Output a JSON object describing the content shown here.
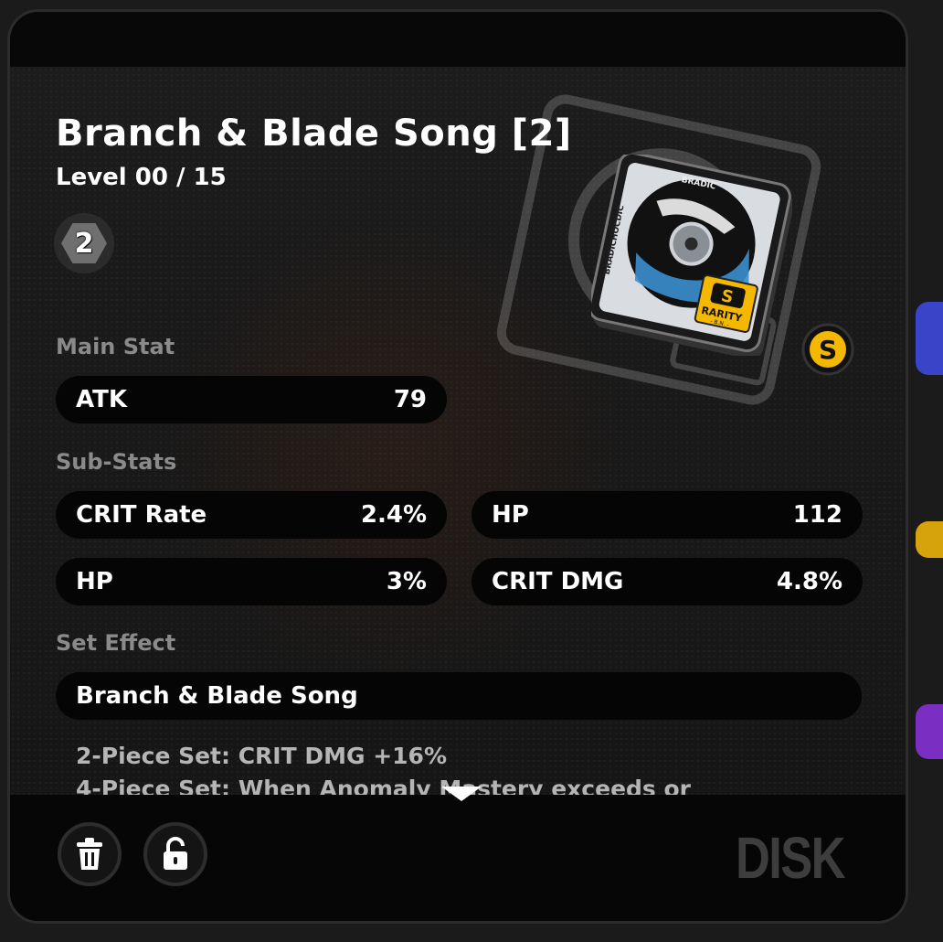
{
  "item": {
    "name": "Branch & Blade Song [2]",
    "level_text": "Level 00 / 15",
    "slot": "2",
    "rarity": "S",
    "rarity_label": "RARITY",
    "rarity_sub": "- B.N. -",
    "disk_brand": "BRADICHOCDIC"
  },
  "main_stat": {
    "label": "Main Stat",
    "name": "ATK",
    "value": "79"
  },
  "sub_stats": {
    "label": "Sub-Stats",
    "items": [
      {
        "name": "CRIT Rate",
        "value": "2.4%"
      },
      {
        "name": "HP",
        "value": "112"
      },
      {
        "name": "HP",
        "value": "3%"
      },
      {
        "name": "CRIT DMG",
        "value": "4.8%"
      }
    ]
  },
  "set_effect": {
    "label": "Set Effect",
    "name": "Branch & Blade Song",
    "lines": [
      "2-Piece Set: CRIT DMG +16%",
      "4-Piece Set: When Anomaly Mastery exceeds or"
    ]
  },
  "footer": {
    "delete_icon": "trash-icon",
    "lock_icon": "unlock-icon",
    "category": "DISK"
  },
  "colors": {
    "panel": "#0b0b0b",
    "pill": "#050505",
    "label_gray": "#8a8a8a",
    "rarity_gold": "#f5b800"
  }
}
